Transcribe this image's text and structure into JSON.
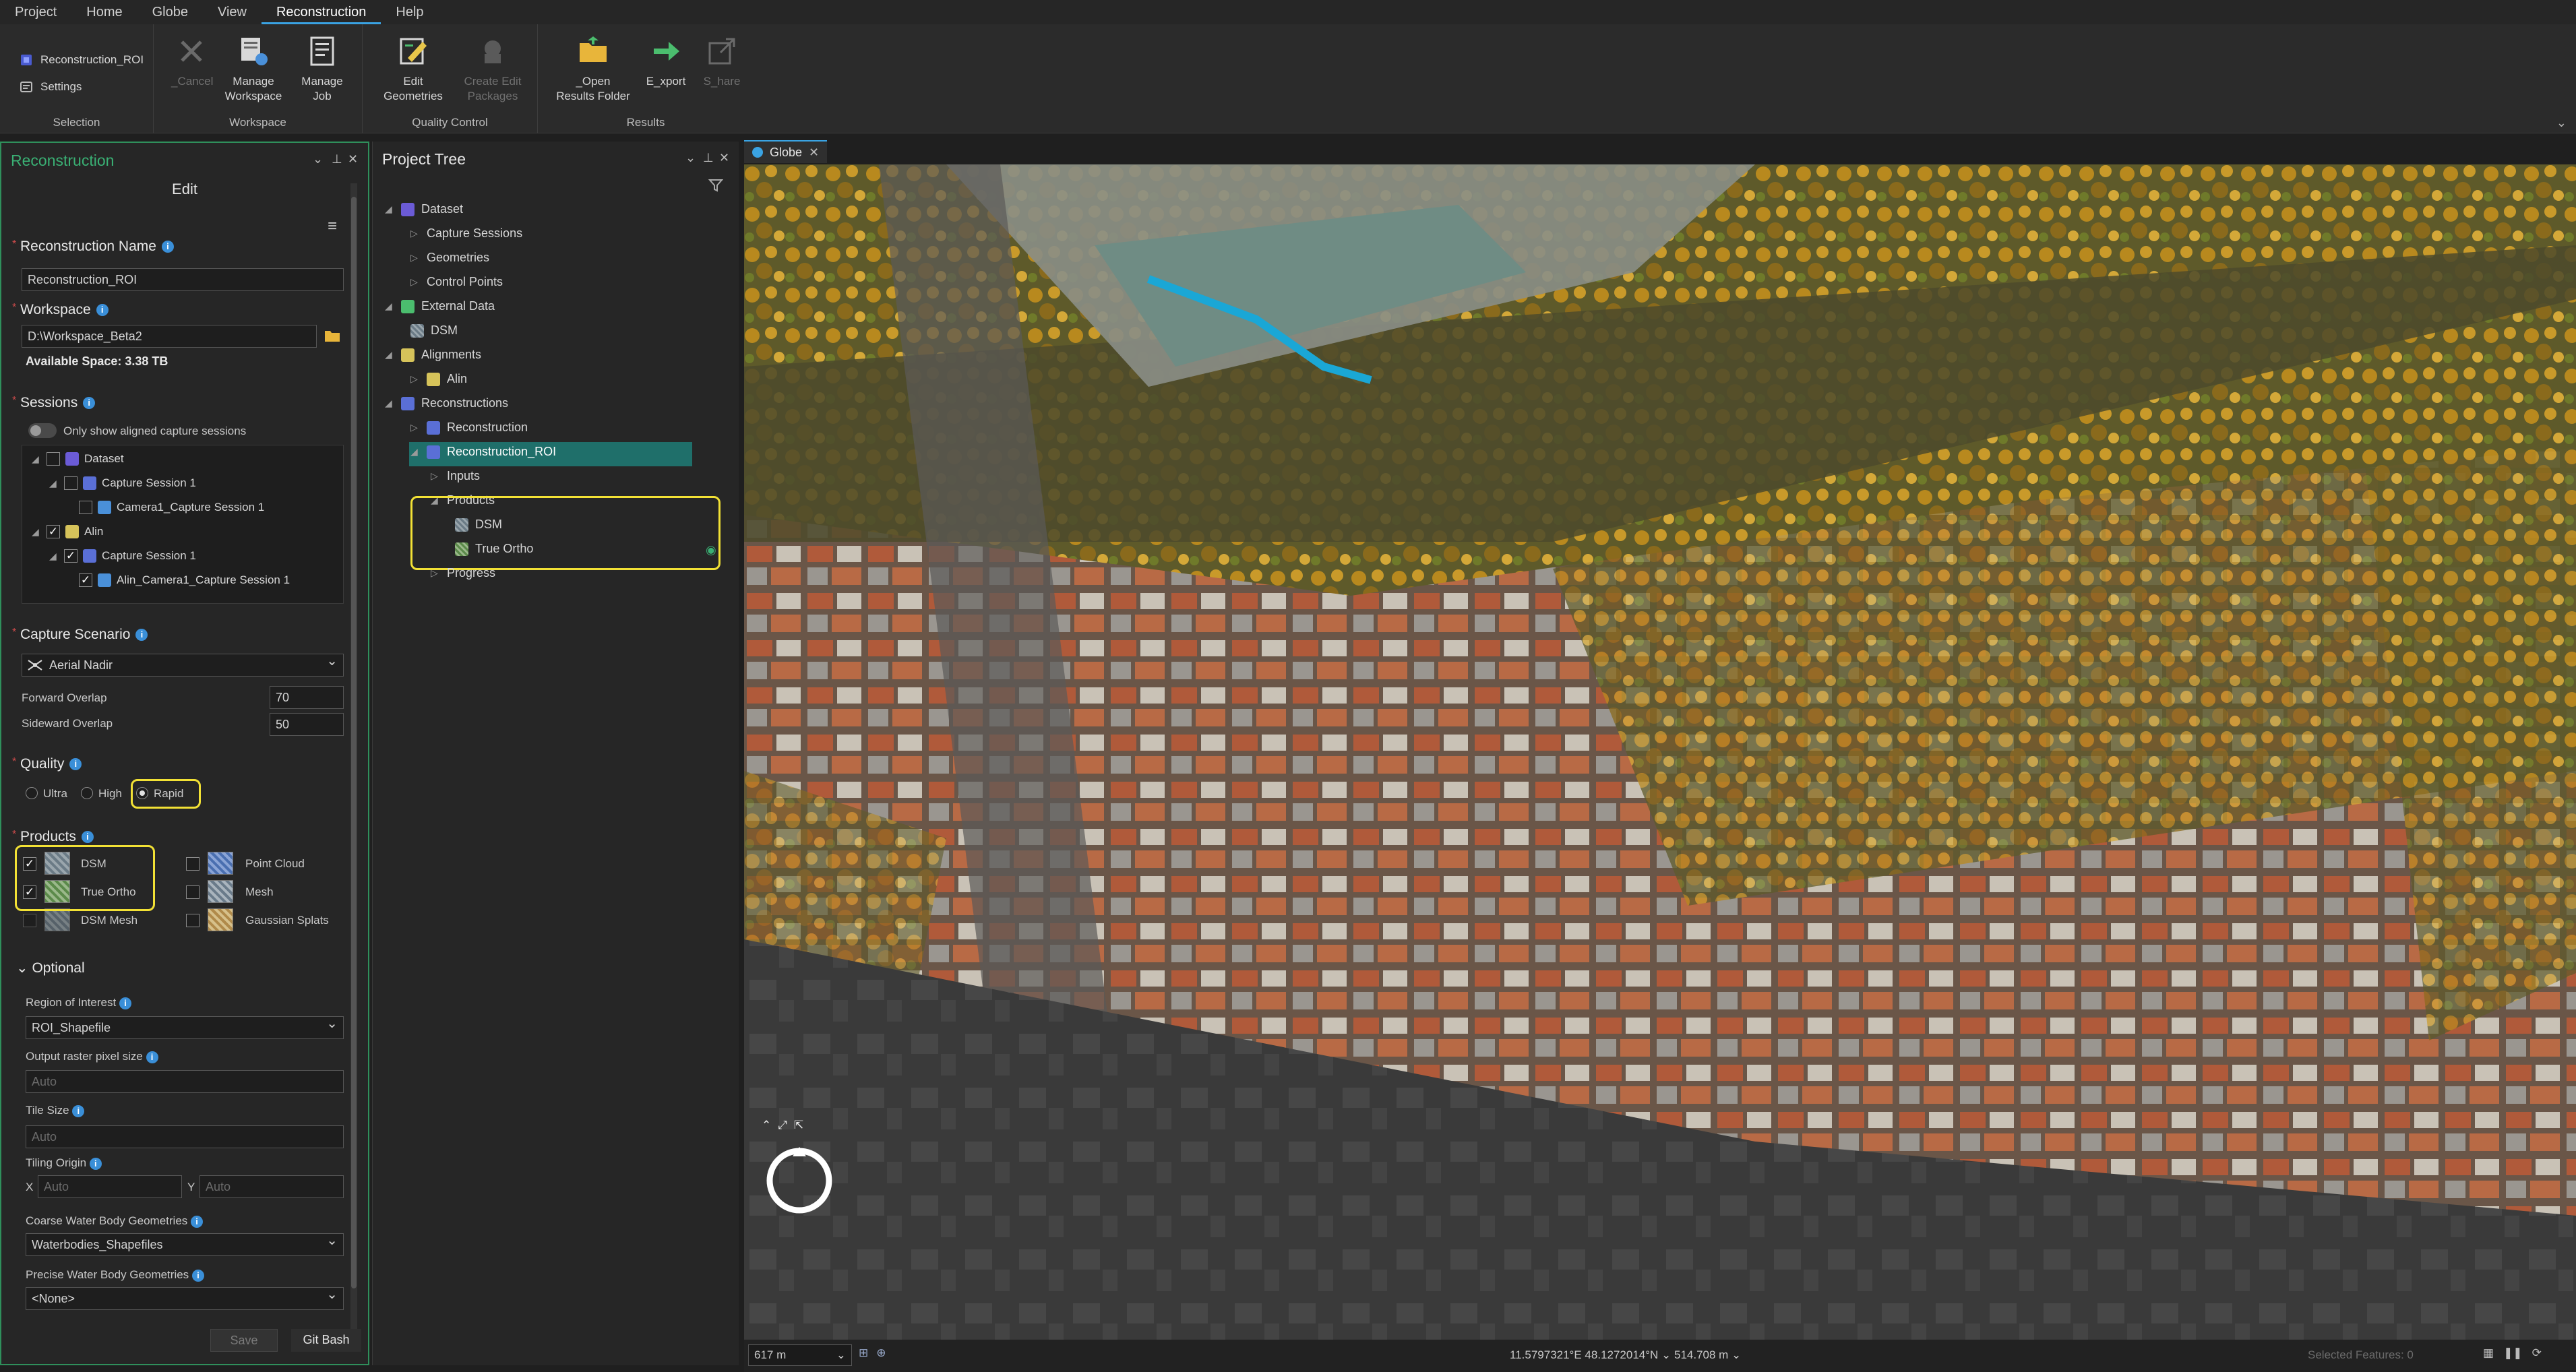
{
  "menu": [
    "Project",
    "Home",
    "Globe",
    "View",
    "Reconstruction",
    "Help"
  ],
  "menu_active": "Reconstruction",
  "ribbon": {
    "selection": {
      "item1": "Reconstruction_ROI",
      "item2": "Settings",
      "group": "Selection"
    },
    "workspace": {
      "cancel": "_Cancel",
      "manage_ws_1": "Manage",
      "manage_ws_2": "Workspace",
      "manage_job_1": "Manage",
      "manage_job_2": "Job",
      "group": "Workspace"
    },
    "quality": {
      "edit_geo_1": "Edit",
      "edit_geo_2": "Geometries",
      "create_1": "Create Edit",
      "create_2": "Packages",
      "group": "Quality Control"
    },
    "results": {
      "open_1": "_Open",
      "open_2": "Results Folder",
      "export": "E_xport",
      "share": "S_hare",
      "group": "Results"
    }
  },
  "recon_panel": {
    "title": "Reconstruction",
    "subtitle": "Edit",
    "name_label": "Reconstruction Name",
    "name_value": "Reconstruction_ROI",
    "workspace_label": "Workspace",
    "workspace_value": "D:\\Workspace_Beta2",
    "space": "Available Space: 3.38 TB",
    "sessions_label": "Sessions",
    "toggle_label": "Only show aligned capture sessions",
    "tree": [
      "Dataset",
      "Capture Session 1",
      "Camera1_Capture Session 1",
      "Alin",
      "Capture Session 1",
      "Alin_Camera1_Capture Session 1"
    ],
    "scenario_label": "Capture Scenario",
    "scenario_value": "Aerial Nadir",
    "forward_label": "Forward Overlap",
    "forward_value": "70",
    "sideward_label": "Sideward Overlap",
    "sideward_value": "50",
    "quality_label": "Quality",
    "quality_options": [
      "Ultra",
      "High",
      "Rapid"
    ],
    "products_label": "Products",
    "products": [
      "DSM",
      "True Ortho",
      "DSM Mesh",
      "Point Cloud",
      "Mesh",
      "Gaussian Splats"
    ],
    "optional_label": "Optional",
    "roi_label": "Region of Interest",
    "roi_value": "ROI_Shapefile",
    "pixel_label": "Output raster pixel size",
    "auto": "Auto",
    "tile_label": "Tile Size",
    "origin_label": "Tiling Origin",
    "x": "X",
    "y": "Y",
    "coarse_label": "Coarse Water Body Geometries",
    "coarse_value": "Waterbodies_Shapefiles",
    "precise_label": "Precise Water Body Geometries",
    "precise_value": "<None>",
    "save": "Save",
    "gitbash": "Git Bash"
  },
  "project_tree": {
    "title": "Project Tree",
    "rows": [
      "Dataset",
      "Capture Sessions",
      "Geometries",
      "Control Points",
      "External Data",
      "DSM",
      "Alignments",
      "Alin",
      "Reconstructions",
      "Reconstruction",
      "Reconstruction_ROI",
      "Inputs",
      "Products",
      "DSM",
      "True Ortho",
      "Progress"
    ]
  },
  "globe": {
    "tab": "Globe",
    "scale": "617 m",
    "coords": "11.5797321°E 48.1272014°N ⌄ 514.708 m ⌄",
    "selected": "Selected Features: 0"
  },
  "colors": {
    "accent_green": "#2f8f5b",
    "highlight_yellow": "#f2e135",
    "selection_teal": "#1f6f6a",
    "river_blue": "#1aa7d6"
  }
}
